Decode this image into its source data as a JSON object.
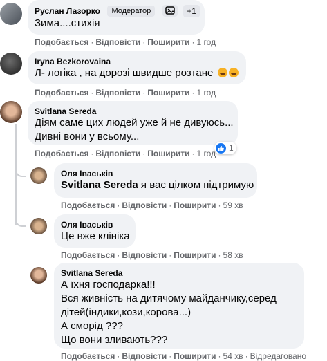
{
  "comments": [
    {
      "author": "Руслан Лазорко",
      "badge": "Модератор",
      "badge_count": "+1",
      "text_lines": [
        "Зима....стихія"
      ],
      "actions": {
        "like": "Подобається",
        "reply": "Відповісти",
        "share": "Поширити",
        "time": "1 год"
      }
    },
    {
      "author": "Iryna Bezkorovaina",
      "text_lines": [
        "Л- логіка , на дорозі швидше розтане"
      ],
      "emojis": [
        "rolling-laughing-emoji",
        "rolling-laughing-emoji"
      ],
      "actions": {
        "like": "Подобається",
        "reply": "Відповісти",
        "share": "Поширити",
        "time": "1 год"
      }
    },
    {
      "author": "Svitlana Sereda",
      "text_lines": [
        "Дiям саме цих людей уже й не дивуюсь...",
        "Дивні вони у всьому..."
      ],
      "reactions": {
        "icon": "like-icon",
        "count": "1"
      },
      "actions": {
        "like": "Подобається",
        "reply": "Відповісти",
        "share": "Поширити",
        "time": "1 год"
      }
    }
  ],
  "replies": [
    {
      "author": "Оля Івaськів",
      "mention": "Svitlana Sereda",
      "text": " я вас цілком підтримую",
      "actions": {
        "like": "Подобається",
        "reply": "Відповісти",
        "share": "Поширити",
        "time": "59 хв"
      }
    },
    {
      "author": "Оля Івaськів",
      "text_lines": [
        "Це вже клініка"
      ],
      "actions": {
        "like": "Подобається",
        "reply": "Відповісти",
        "share": "Поширити",
        "time": "58 хв"
      }
    },
    {
      "author": "Svitlana Sereda",
      "text_lines": [
        "А їхня господарка!!!",
        "Вся живність на дитячому майданчику,серед",
        "дітей(індики,кози,корова...)",
        "А сморід ???",
        "Що вони зливають???"
      ],
      "actions": {
        "like": "Подобається",
        "reply": "Відповісти",
        "share": "Поширити",
        "time": "54 хв",
        "edited": "Відредаговано"
      }
    }
  ],
  "colors": {
    "bubble": "#f0f2f5",
    "meta": "#65676b",
    "like_blue": "#1877f2"
  }
}
